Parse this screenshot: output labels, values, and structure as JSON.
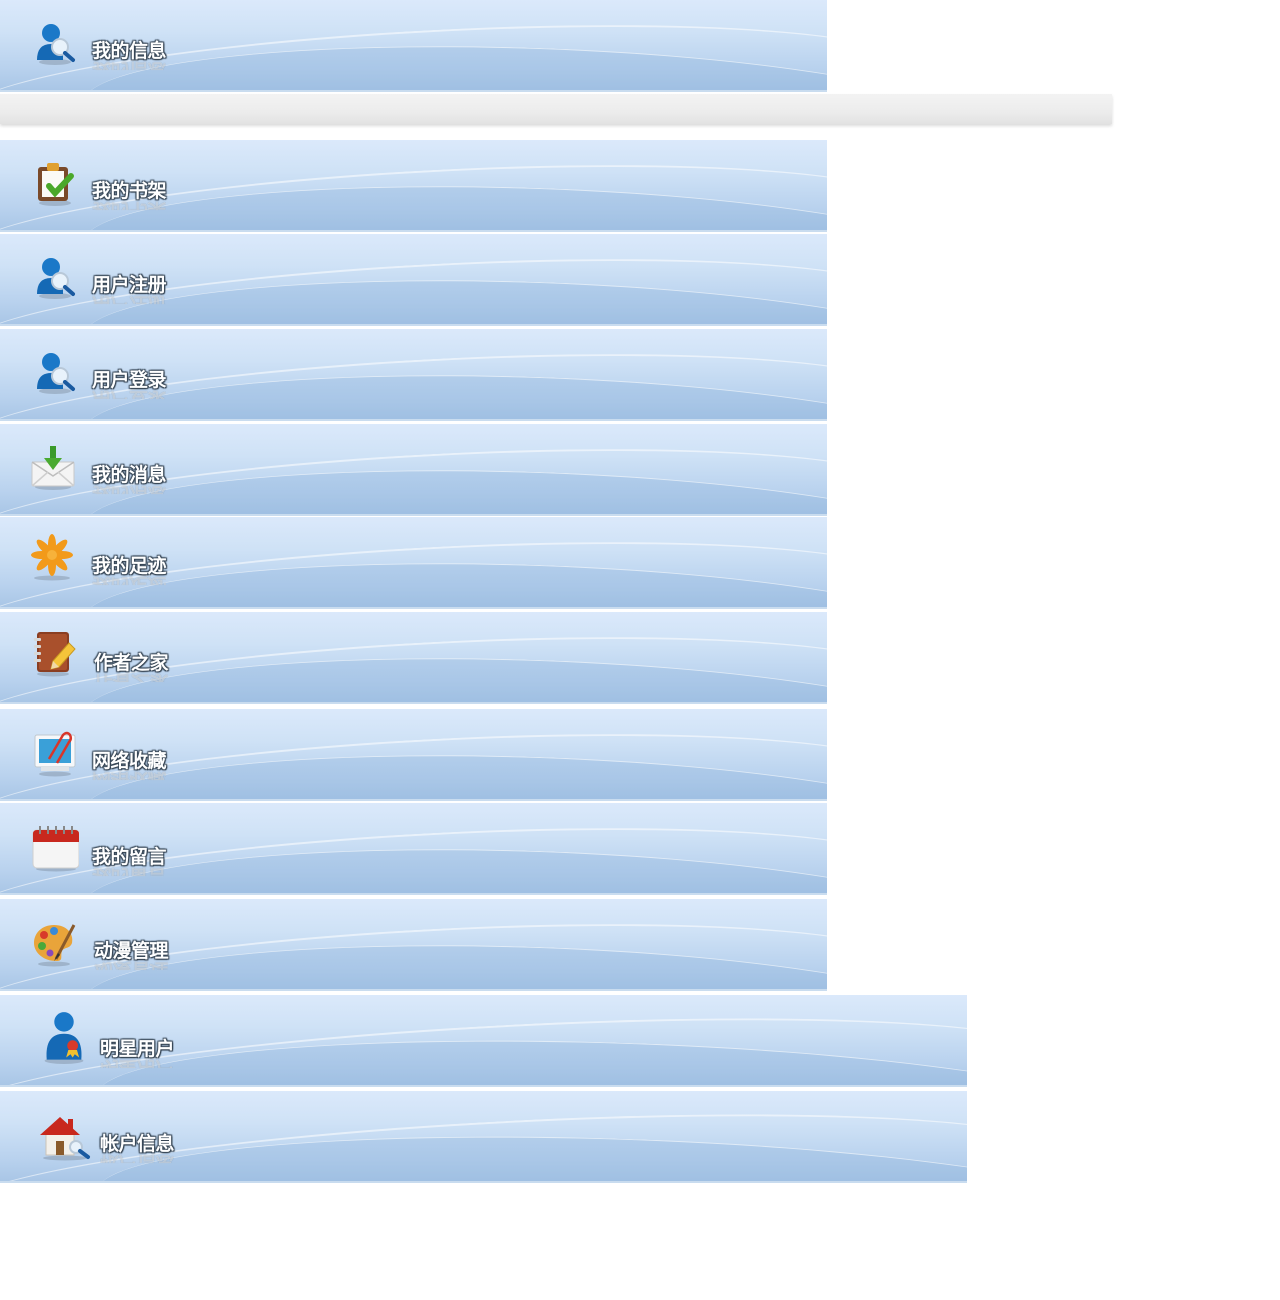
{
  "menu": {
    "items": [
      {
        "label": "我的信息",
        "icon": "user-search-icon"
      },
      {
        "label": "我的书架",
        "icon": "clipboard-check-icon"
      },
      {
        "label": "用户注册",
        "icon": "user-search-icon"
      },
      {
        "label": "用户登录",
        "icon": "user-search-icon"
      },
      {
        "label": "我的消息",
        "icon": "envelope-download-icon"
      },
      {
        "label": "我的足迹",
        "icon": "asterisk-flower-icon"
      },
      {
        "label": "作者之家",
        "icon": "notebook-pencil-icon"
      },
      {
        "label": "网络收藏",
        "icon": "paperclip-monitor-icon"
      },
      {
        "label": "我的留言",
        "icon": "calendar-icon"
      },
      {
        "label": "动漫管理",
        "icon": "palette-brush-icon"
      },
      {
        "label": "明星用户",
        "icon": "user-badge-icon"
      },
      {
        "label": "帐户信息",
        "icon": "house-search-icon"
      }
    ]
  },
  "colors": {
    "banner_top": "#dbe9fb",
    "banner_bottom": "#a9c6e6",
    "grey_bar": "#ececec",
    "label_text": "#ffffff"
  }
}
